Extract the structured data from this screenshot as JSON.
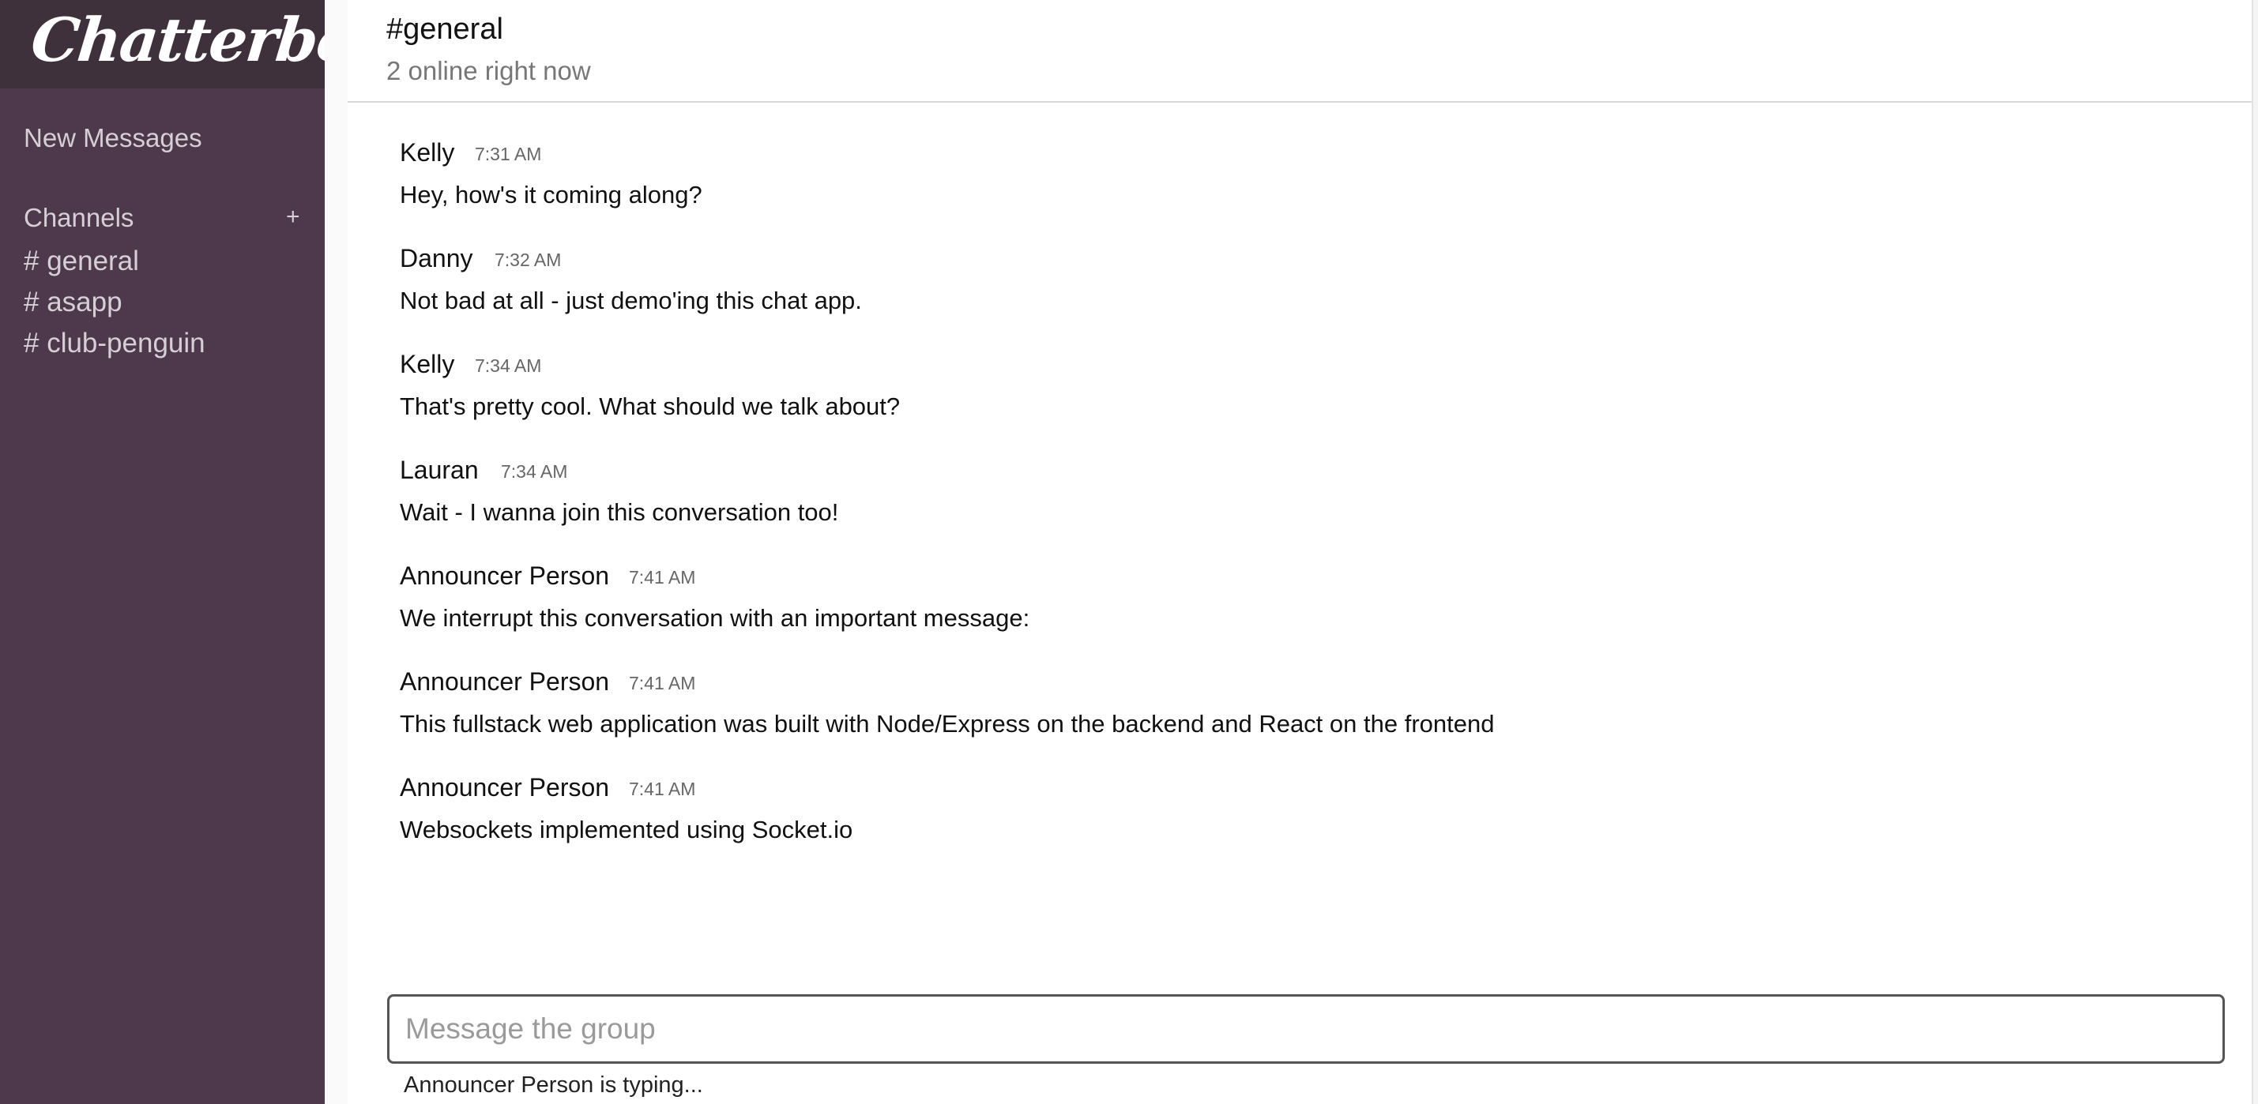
{
  "app": {
    "name": "Chatterbox",
    "colors": {
      "sidebar_bg": "#4d394b",
      "logo_bar_bg": "#3e313c",
      "sidebar_text": "#d6cfd5"
    }
  },
  "sidebar": {
    "new_messages_label": "New Messages",
    "channels_label": "Channels",
    "add_channel_label": "+",
    "channels": [
      {
        "label": "# general"
      },
      {
        "label": "# asapp"
      },
      {
        "label": "# club-penguin"
      }
    ]
  },
  "header": {
    "title": "#general",
    "subtitle": "2 online right now"
  },
  "messages": [
    {
      "author": "Kelly",
      "time": "7:31 AM",
      "text": "Hey, how's it coming along?"
    },
    {
      "author": "Danny",
      "time": "7:32 AM",
      "text": "Not bad at all - just demo'ing this chat app."
    },
    {
      "author": "Kelly",
      "time": "7:34 AM",
      "text": "That's pretty cool. What should we talk about?"
    },
    {
      "author": "Lauran",
      "time": "7:34 AM",
      "text": "Wait - I wanna join this conversation too!"
    },
    {
      "author": "Announcer Person",
      "time": "7:41 AM",
      "text": "We interrupt this conversation with an important message:"
    },
    {
      "author": "Announcer Person",
      "time": "7:41 AM",
      "text": "This fullstack web application was built with Node/Express on the backend and React on the frontend"
    },
    {
      "author": "Announcer Person",
      "time": "7:41 AM",
      "text": "Websockets implemented using Socket.io"
    }
  ],
  "composer": {
    "placeholder": "Message the group",
    "value": ""
  },
  "typing_indicator": "Announcer Person is typing..."
}
